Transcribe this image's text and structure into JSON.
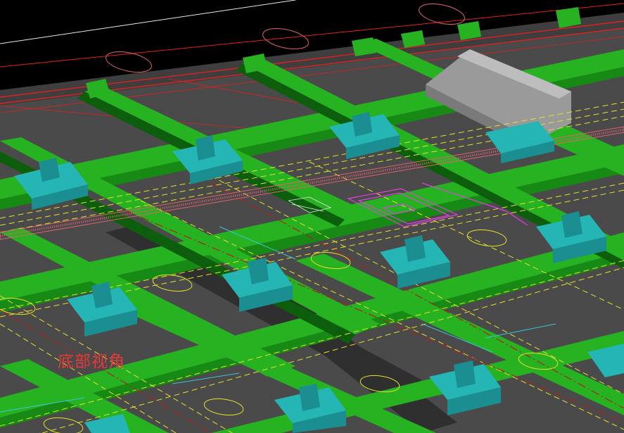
{
  "viewport": {
    "label": "底部视角"
  },
  "colors": {
    "background": "#000000",
    "slab": "#4a4a4a",
    "slab_shadow": "#2a2a2a",
    "beam_top": "#27b321",
    "beam_side": "#168a14",
    "beam_dark": "#0d5e0c",
    "cap_top": "#25b5b5",
    "cap_side": "#1a8e90",
    "cap_dark": "#116a6c",
    "block_light": "#bdbdbd",
    "block_mid": "#9a9a9a",
    "block_dark": "#7a7a7a",
    "red_line": "#e02020",
    "yellow_line": "#e6e02a",
    "cyan_line": "#39c6d6",
    "magenta_line": "#e040e0",
    "white_line": "#e8e8e8",
    "pink_line": "#e06070",
    "label": "#e23a3a"
  },
  "icons": {
    "view_label": "text-label"
  }
}
